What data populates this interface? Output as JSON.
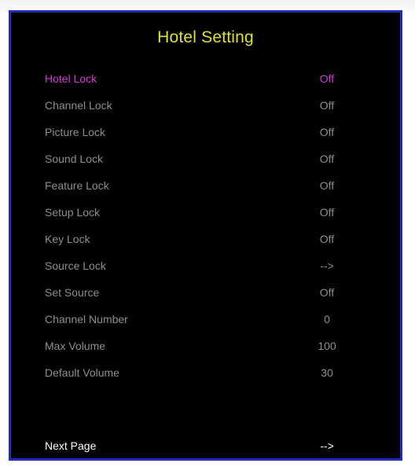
{
  "title": "Hotel Setting",
  "colors": {
    "frame_border": "#1f2fb8",
    "background": "#000000",
    "title": "#e0e030",
    "active_item": "#d63ad6",
    "item": "#8e8e8e",
    "next_item": "#ffffff"
  },
  "items": [
    {
      "label": "Hotel Lock",
      "value": "Off",
      "selected": true
    },
    {
      "label": "Channel Lock",
      "value": "Off"
    },
    {
      "label": "Picture Lock",
      "value": "Off"
    },
    {
      "label": "Sound Lock",
      "value": "Off"
    },
    {
      "label": "Feature Lock",
      "value": "Off"
    },
    {
      "label": "Setup Lock",
      "value": "Off"
    },
    {
      "label": "Key Lock",
      "value": "Off"
    },
    {
      "label": "Source Lock",
      "value": "-->"
    },
    {
      "label": "Set Source",
      "value": "Off"
    },
    {
      "label": "Channel Number",
      "value": "0"
    },
    {
      "label": "Max Volume",
      "value": "100"
    },
    {
      "label": "Default Volume",
      "value": "30"
    }
  ],
  "next_page": {
    "label": "Next Page",
    "value": "-->"
  }
}
